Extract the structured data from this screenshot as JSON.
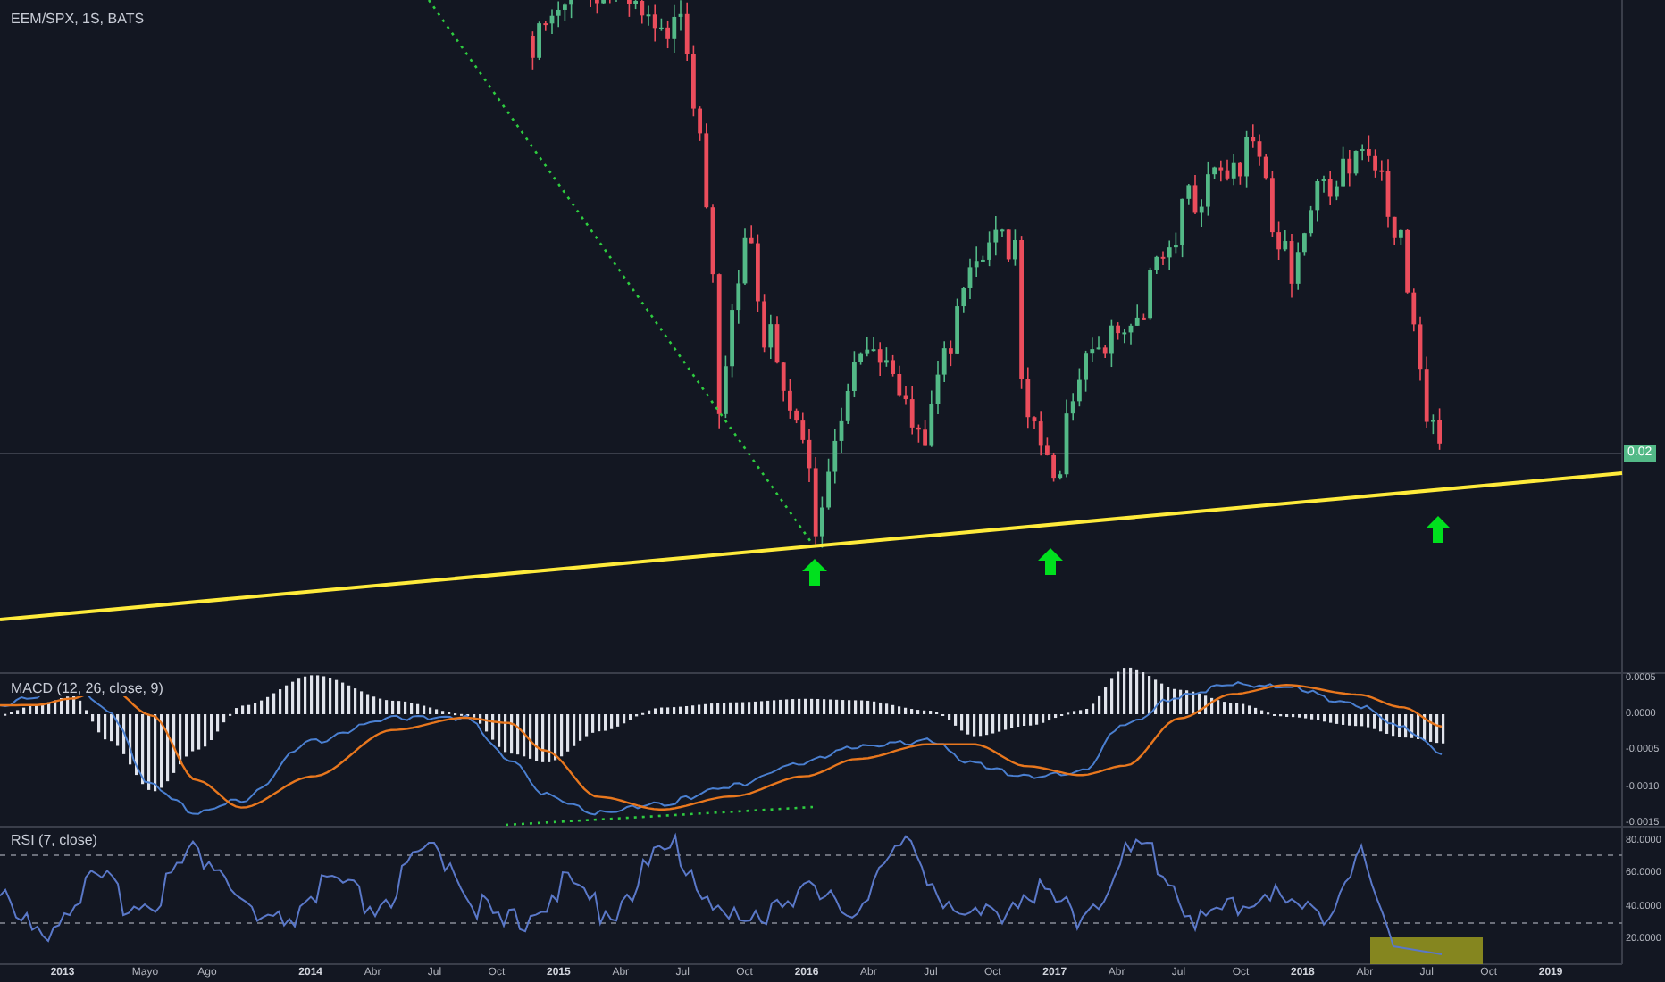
{
  "symbol_legend": "EEM/SPX, 1S, BATS",
  "price_axis": {
    "last_price": "0.02"
  },
  "macd_pane": {
    "legend": "MACD (12, 26, close, 9)",
    "axis_labels": [
      "0.0005",
      "0.0000",
      "-0.0005",
      "-0.0010",
      "-0.0015"
    ]
  },
  "rsi_pane": {
    "legend": "RSI (7, close)",
    "axis_labels": [
      "80.0000",
      "60.0000",
      "40.0000",
      "20.0000"
    ]
  },
  "time_axis": {
    "labels": [
      {
        "label": "2013",
        "kind": "year"
      },
      {
        "label": "Mayo",
        "kind": "month"
      },
      {
        "label": "Ago",
        "kind": "month"
      },
      {
        "label": "2014",
        "kind": "year"
      },
      {
        "label": "Abr",
        "kind": "month"
      },
      {
        "label": "Jul",
        "kind": "month"
      },
      {
        "label": "Oct",
        "kind": "month"
      },
      {
        "label": "2015",
        "kind": "year"
      },
      {
        "label": "Abr",
        "kind": "month"
      },
      {
        "label": "Jul",
        "kind": "month"
      },
      {
        "label": "Oct",
        "kind": "month"
      },
      {
        "label": "2016",
        "kind": "year"
      },
      {
        "label": "Abr",
        "kind": "month"
      },
      {
        "label": "Jul",
        "kind": "month"
      },
      {
        "label": "Oct",
        "kind": "month"
      },
      {
        "label": "2017",
        "kind": "year"
      },
      {
        "label": "Abr",
        "kind": "month"
      },
      {
        "label": "Jul",
        "kind": "month"
      },
      {
        "label": "Oct",
        "kind": "month"
      },
      {
        "label": "2018",
        "kind": "year"
      },
      {
        "label": "Abr",
        "kind": "month"
      },
      {
        "label": "Jul",
        "kind": "month"
      },
      {
        "label": "Oct",
        "kind": "month"
      },
      {
        "label": "2019",
        "kind": "year"
      }
    ]
  }
}
